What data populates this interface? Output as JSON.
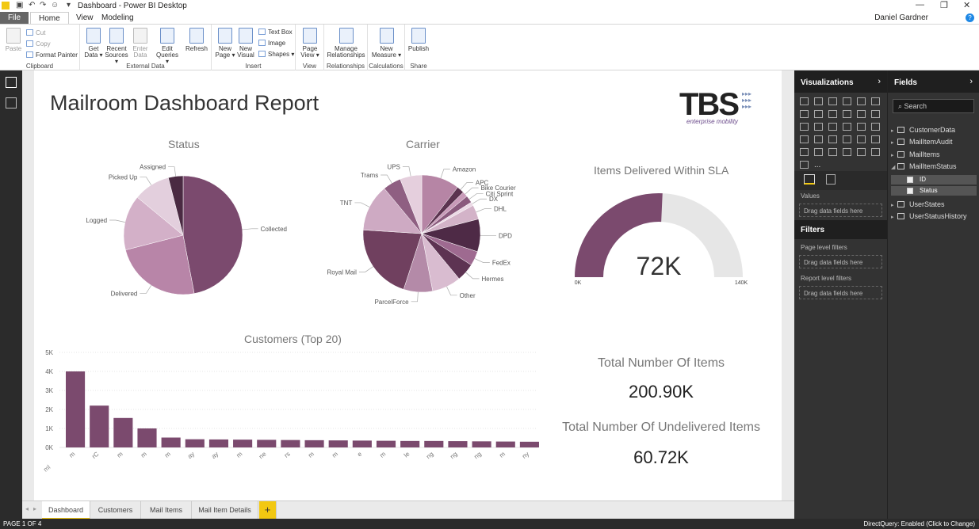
{
  "window": {
    "title": "Dashboard - Power BI Desktop",
    "user": "Daniel Gardner",
    "help": "?"
  },
  "menu_tabs": {
    "file": "File",
    "home": "Home",
    "view": "View",
    "modeling": "Modeling"
  },
  "ribbon": {
    "clipboard": {
      "label": "Clipboard",
      "paste": "Paste",
      "cut": "Cut",
      "copy": "Copy",
      "format_painter": "Format Painter"
    },
    "external": {
      "label": "External Data",
      "get_data": [
        "Get",
        "Data ▾"
      ],
      "recent": [
        "Recent",
        "Sources ▾"
      ],
      "enter": [
        "Enter",
        "Data"
      ],
      "edit": [
        "Edit",
        "Queries ▾"
      ],
      "refresh": "Refresh"
    },
    "insert": {
      "label": "Insert",
      "new_page": [
        "New",
        "Page ▾"
      ],
      "new_visual": [
        "New",
        "Visual"
      ],
      "text_box": "Text Box",
      "image": "Image",
      "shapes": "Shapes ▾"
    },
    "view": {
      "label": "View",
      "page_view": [
        "Page",
        "View ▾"
      ]
    },
    "relationships": {
      "label": "Relationships",
      "manage": [
        "Manage",
        "Relationships"
      ]
    },
    "calculations": {
      "label": "Calculations",
      "new_measure": [
        "New",
        "Measure ▾"
      ]
    },
    "share": {
      "label": "Share",
      "publish": "Publish"
    }
  },
  "report": {
    "title": "Mailroom Dashboard Report",
    "logo_text": "TBS",
    "logo_tagline": "enterprise mobility"
  },
  "status_chart": {
    "title": "Status"
  },
  "carrier_chart": {
    "title": "Carrier"
  },
  "gauge": {
    "title": "Items Delivered Within SLA",
    "value_label": "72K",
    "min_label": "0K",
    "max_label": "140K"
  },
  "customers_chart": {
    "title": "Customers (Top 20)",
    "corner_label": "ml"
  },
  "cards": {
    "total_title": "Total Number Of Items",
    "total_value": "200.90K",
    "undelivered_title": "Total Number Of Undelivered Items",
    "undelivered_value": "60.72K"
  },
  "page_tabs": {
    "t1": "Dashboard",
    "t2": "Customers",
    "t3": "Mail Items",
    "t4": "Mail Item Details",
    "add": "+"
  },
  "statusbar": {
    "left": "PAGE 1 OF 4",
    "right": "DirectQuery: Enabled (Click to Change)"
  },
  "viz_pane": {
    "title": "Visualizations",
    "values": "Values",
    "drag_values": "Drag data fields here",
    "filters_title": "Filters",
    "page_filters": "Page level filters",
    "drag_page": "Drag data fields here",
    "report_filters": "Report level filters",
    "drag_report": "Drag data fields here",
    "more": "..."
  },
  "fields_pane": {
    "title": "Fields",
    "search_placeholder": "Search",
    "tables": [
      "CustomerData",
      "MailItemAudit",
      "MailItems",
      "MailItemStatus",
      "UserStates",
      "UserStatusHistory"
    ],
    "subfields": [
      "ID",
      "Status"
    ]
  },
  "chart_data": [
    {
      "type": "pie",
      "title": "Status",
      "categories": [
        "Collected",
        "Delivered",
        "Logged",
        "Picked Up",
        "Assigned"
      ],
      "values": [
        47,
        24,
        15,
        10,
        4
      ],
      "colors": [
        "#7b4a6e",
        "#b885a8",
        "#d3b0c8",
        "#e3cfdd",
        "#4a2a42"
      ]
    },
    {
      "type": "pie",
      "title": "Carrier",
      "categories": [
        "Amazon",
        "APC",
        "Bike Courier",
        "Citi Sprint",
        "DX",
        "DHL",
        "DPD",
        "FedEx",
        "Hermes",
        "Other",
        "ParcelForce",
        "Royal Mail",
        "TNT",
        "Trams",
        "UPS"
      ],
      "values": [
        10.5,
        2,
        1.5,
        2,
        1,
        4,
        9,
        4,
        5,
        8,
        8,
        21,
        13,
        5,
        6
      ],
      "colors": [
        "#b685a5",
        "#5c3450",
        "#c99bb9",
        "#8a5a7d",
        "#ebd9e5",
        "#d3b3c8",
        "#4e2a46",
        "#9e6a90",
        "#5d3352",
        "#d9bcd0",
        "#b48aa8",
        "#70405f",
        "#ceaac3",
        "#8f5f82",
        "#e5cfdd"
      ]
    },
    {
      "type": "gauge",
      "title": "Items Delivered Within SLA",
      "value": 72,
      "min": 0,
      "max": 140,
      "unit": "K"
    },
    {
      "type": "bar",
      "title": "Customers (Top 20)",
      "categories": [
        "m",
        "rC",
        "m",
        "m",
        "m",
        "ay",
        "ay",
        "m",
        "ne",
        "rs",
        "m",
        "m",
        "e",
        "m",
        "le",
        "ng",
        "ng",
        "ng",
        "m",
        "ny"
      ],
      "values": [
        4000,
        2200,
        1550,
        1000,
        520,
        430,
        420,
        410,
        400,
        390,
        380,
        370,
        360,
        350,
        340,
        340,
        330,
        320,
        310,
        300
      ],
      "ylim": [
        0,
        5000
      ],
      "yticks": [
        "0K",
        "1K",
        "2K",
        "3K",
        "4K",
        "5K"
      ],
      "color": "#7b4a6e"
    },
    {
      "type": "table",
      "title": "Total Number Of Items",
      "values": [
        "200.90K"
      ]
    },
    {
      "type": "table",
      "title": "Total Number Of Undelivered Items",
      "values": [
        "60.72K"
      ]
    }
  ]
}
